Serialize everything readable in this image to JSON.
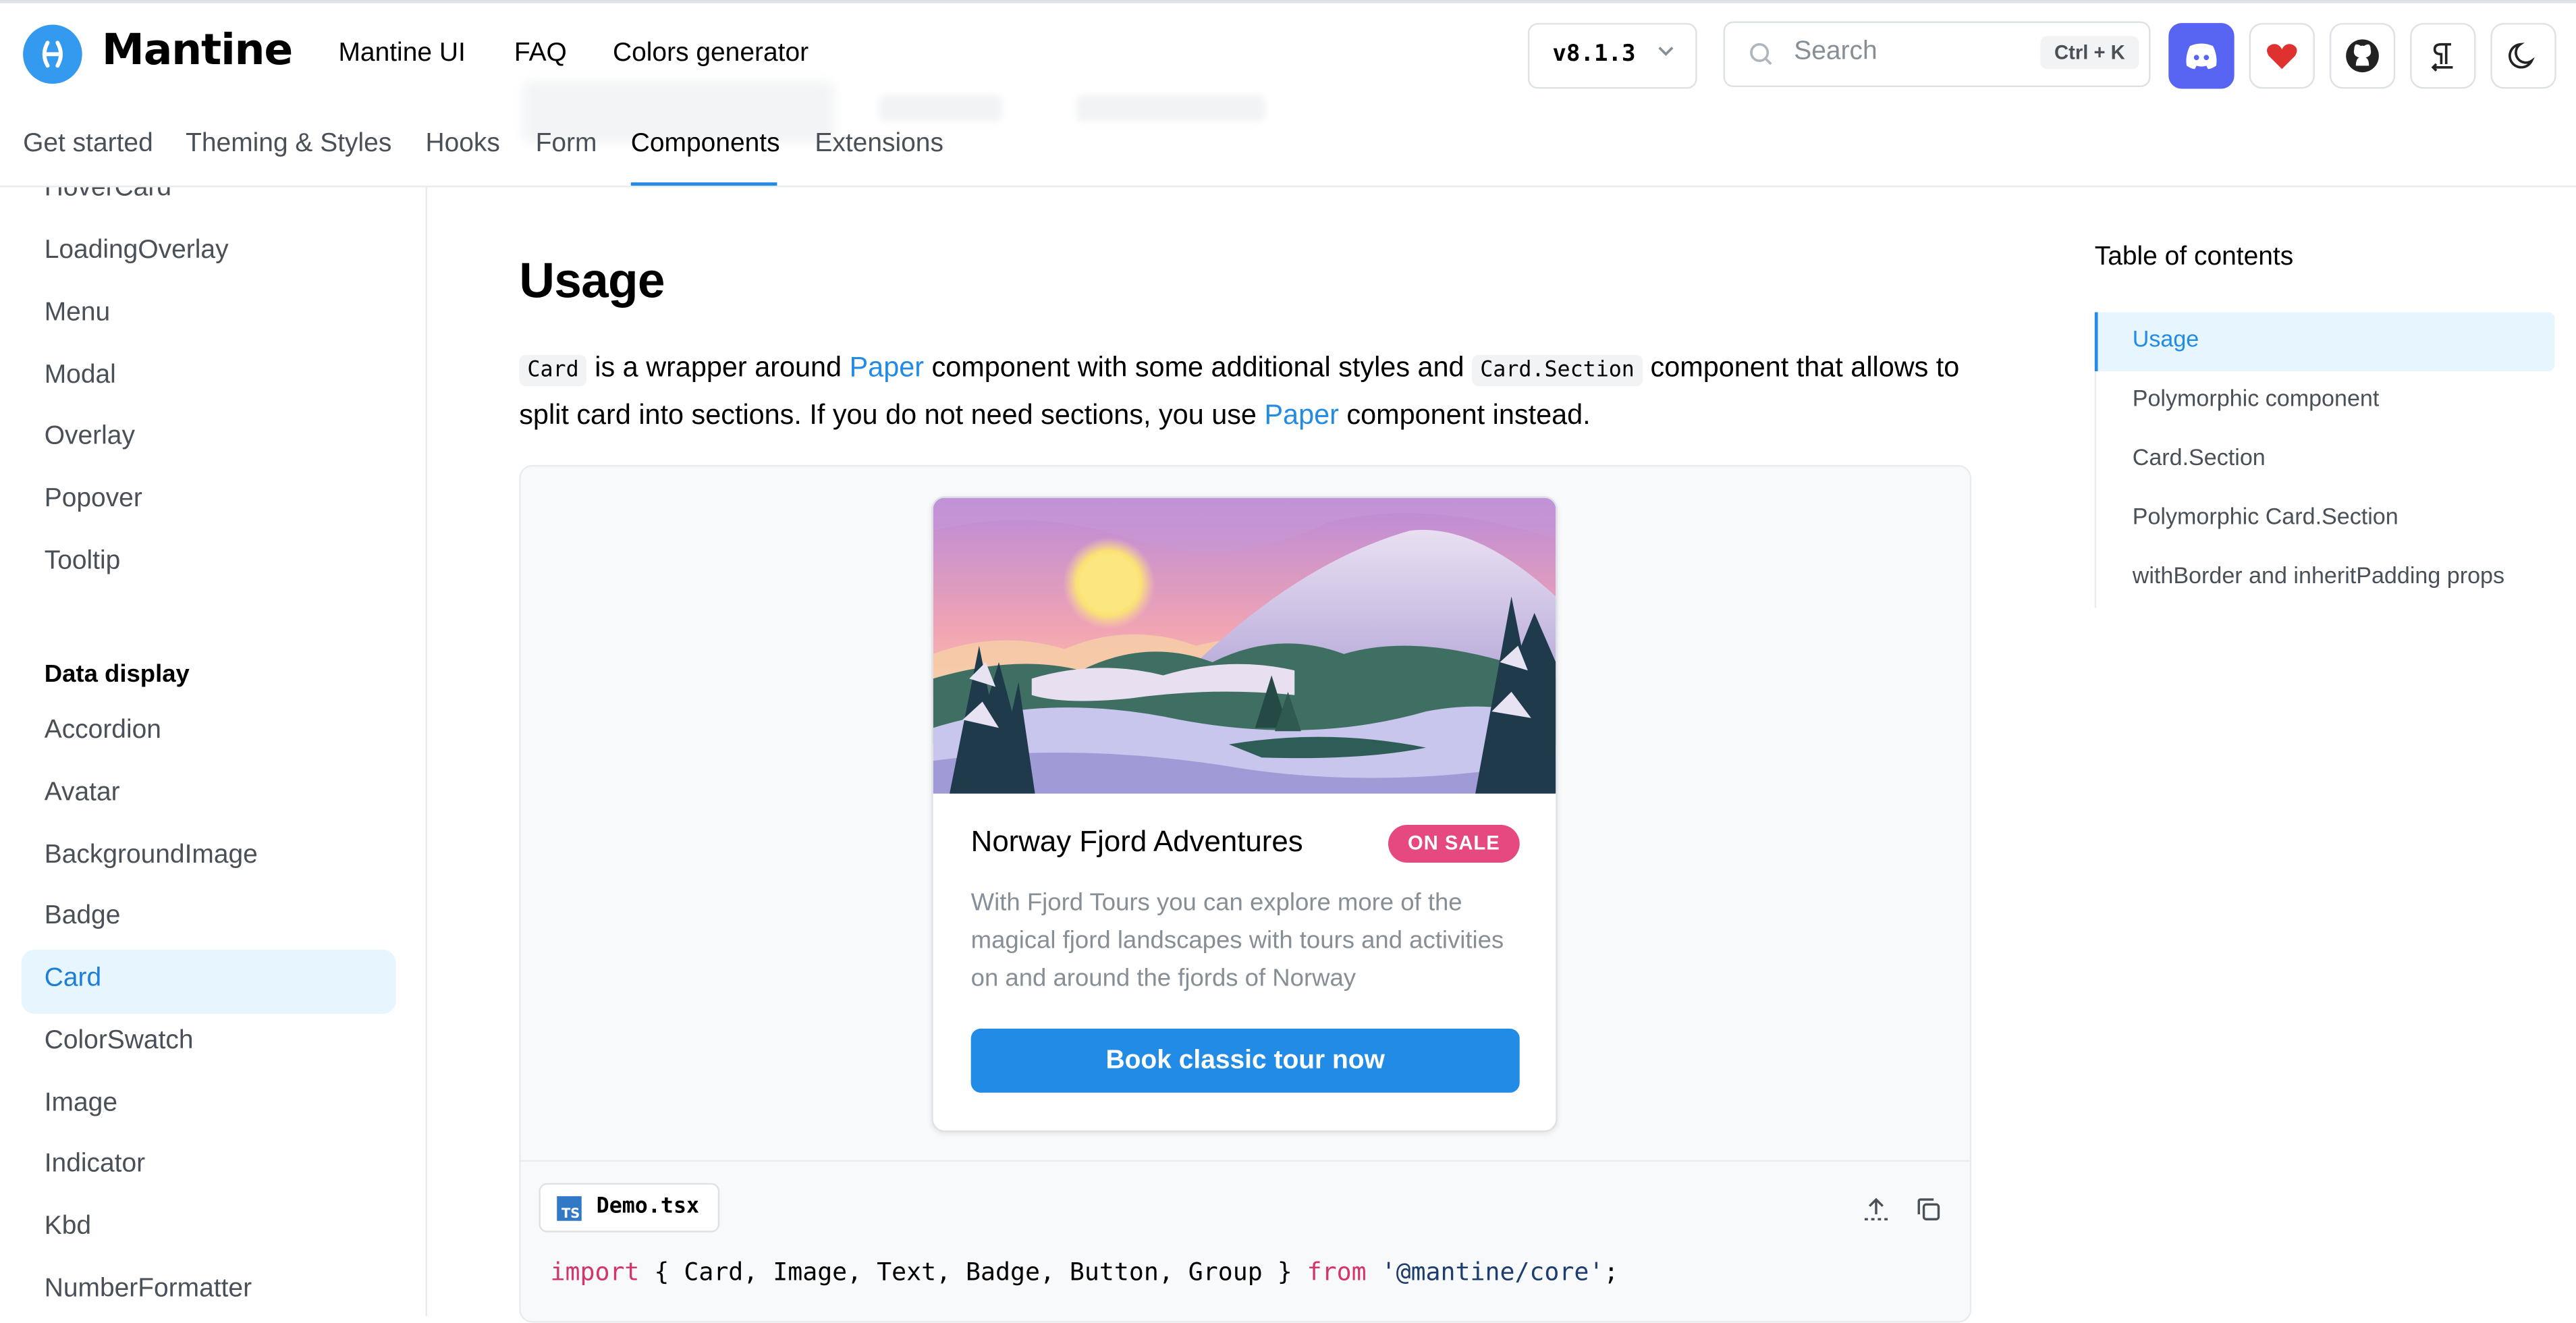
{
  "header": {
    "logo_text": "Mantine",
    "links": [
      "Mantine UI",
      "FAQ",
      "Colors generator"
    ],
    "version": "v8.1.3",
    "search": {
      "placeholder": "Search",
      "shortcut": "Ctrl + K"
    }
  },
  "tabs": [
    "Get started",
    "Theming & Styles",
    "Hooks",
    "Form",
    "Components",
    "Extensions"
  ],
  "active_tab": "Components",
  "sidebar": {
    "items_top": [
      "HoverCard",
      "LoadingOverlay",
      "Menu",
      "Modal",
      "Overlay",
      "Popover",
      "Tooltip"
    ],
    "section_heading": "Data display",
    "items_data": [
      "Accordion",
      "Avatar",
      "BackgroundImage",
      "Badge",
      "Card",
      "ColorSwatch",
      "Image",
      "Indicator",
      "Kbd",
      "NumberFormatter"
    ],
    "active_item": "Card"
  },
  "main": {
    "heading": "Usage",
    "para": {
      "code_card": "Card",
      "t1": " is a wrapper around ",
      "link_paper": "Paper",
      "t2": " component with some additional styles and ",
      "code_section": "Card.Section",
      "t3": " component that allows to split card into sections. If you do not need sections, you use ",
      "link_paper2": "Paper",
      "t4": " component instead."
    },
    "demo_card": {
      "title": "Norway Fjord Adventures",
      "badge": "ON SALE",
      "description": "With Fjord Tours you can explore more of the magical fjord landscapes with tours and activities on and around the fjords of Norway",
      "button": "Book classic tour now"
    },
    "code": {
      "file_icon": "TS",
      "filename": "Demo.tsx",
      "kw_import": "import",
      "imports": " { Card, Image, Text, Badge, Button, Group } ",
      "kw_from": "from",
      "module": " '@mantine/core'",
      "semicolon": ";"
    }
  },
  "toc": {
    "title": "Table of contents",
    "items": [
      "Usage",
      "Polymorphic component",
      "Card.Section",
      "Polymorphic Card.Section",
      "withBorder and inheritPadding props"
    ],
    "active": "Usage"
  },
  "colors": {
    "accent": "#228be6",
    "badge": "#e64980",
    "discord": "#5865f2",
    "heart": "#e03131"
  }
}
